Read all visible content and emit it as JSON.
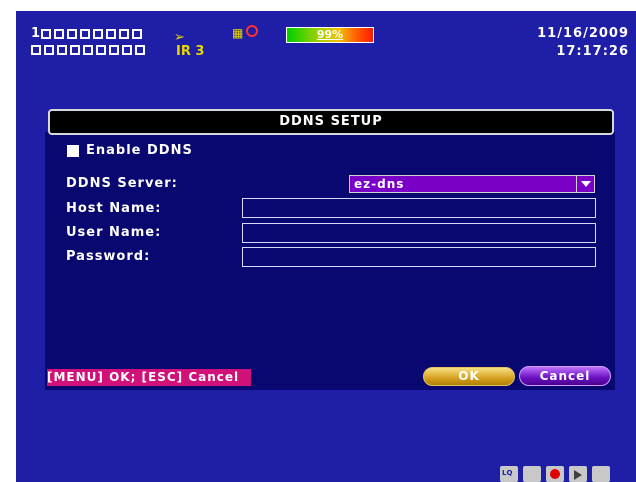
{
  "status": {
    "channel_number": "1",
    "ir_label": "IR 3",
    "disk_usage_text": "99%",
    "date": "11/16/2009",
    "time": "17:17:26"
  },
  "dialog": {
    "title": "DDNS SETUP",
    "enable_label": "Enable DDNS",
    "enable_checked": false,
    "server_label": "DDNS Server:",
    "server_value": "ez-dns",
    "host_label": "Host Name:",
    "host_value": "",
    "user_label": "User Name:",
    "user_value": "",
    "password_label": "Password:",
    "password_value": ""
  },
  "footer": {
    "hint": "[MENU] OK; [ESC] Cancel",
    "ok_label": "OK",
    "cancel_label": "Cancel"
  },
  "toolbar": {
    "icons": [
      "lq-icon",
      "monitor-icon",
      "record-icon",
      "play-icon",
      "search-icon"
    ]
  },
  "colors": {
    "background": "#1e1ea6",
    "dialog_body": "#080870",
    "select": "#7a00c8",
    "hint": "#d0117a"
  }
}
